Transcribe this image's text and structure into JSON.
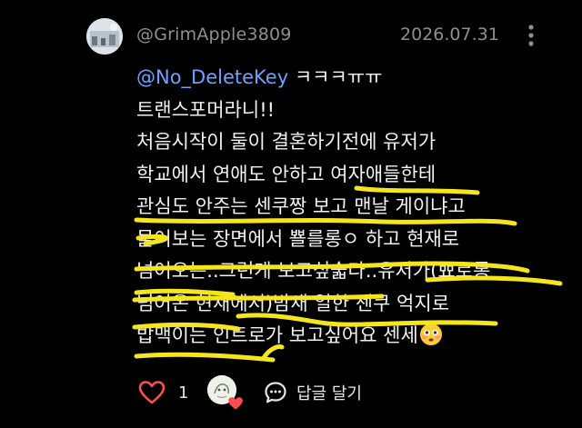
{
  "comment": {
    "author": "@GrimApple3809",
    "date": "2026.07.31",
    "mention": "@No_DeleteKey",
    "first_line_rest": " ㅋㅋㅋㅠㅠ",
    "lines": [
      "트랜스포머라니!!",
      "처음시작이 둘이 결혼하기전에 유저가",
      "학교에서 연애도 안하고 여자애들한테",
      "관심도 안주는 센쿠짱 보고 맨날 게이냐고",
      "물어보는 장면에서 뾸를롱ㅇ 하고 현재로",
      "넘어오는..그런게 보고싶숣다..유저가(뾰로롱",
      "넘어온 현재에서)밤새 일한 센쿠 억지로",
      "밥맥이는 인트로가 보고싶어요 센세"
    ],
    "emoji": "flushed-face-emoji",
    "highlight_color": "#f5e61c"
  },
  "actions": {
    "like_count": "1",
    "reply_label": "답글 달기",
    "like_icon": "heart-outline-icon",
    "liked_badge_icon": "heart-filled-icon",
    "heart_color": "#ff4d4d"
  }
}
